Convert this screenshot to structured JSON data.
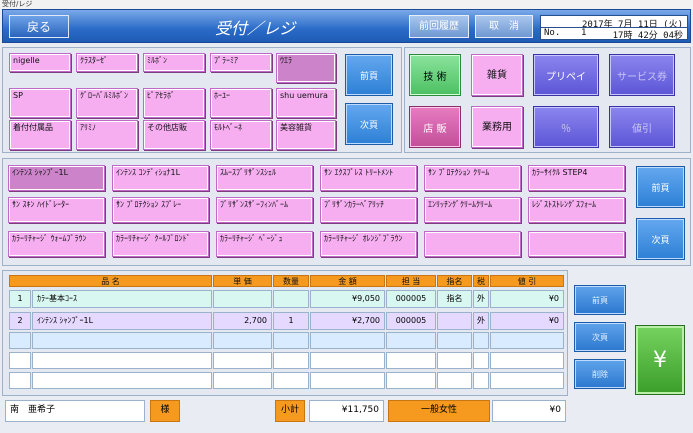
{
  "window": {
    "title": "受付/レジ"
  },
  "header": {
    "back_label": "戻る",
    "title": "受付／レジ",
    "history_label": "前回履歴",
    "cancel_label": "取　消",
    "date": "2017年 7月 11日 (火)",
    "no_label": "No.",
    "no_value": "1",
    "time": "17時 42分 04秒"
  },
  "categories": [
    "nigelle",
    "ｸﾗｽﾀｰｾﾞ",
    "ﾐﾙﾎﾞﾝ",
    "ﾌﾟﾗｰﾐｱ",
    "ｳｴﾗ",
    "SP",
    "ｸﾞﾛｰﾊﾞﾙﾐﾙﾎﾞﾝ",
    "ﾋﾟｱｾﾗﾎﾞ",
    "ﾎｰﾕｰ",
    "shu uemura",
    "着付付属品",
    "ｱﾘﾐﾉ",
    "その他店販",
    "ﾓﾙﾄﾍﾞｰﾈ",
    "美容雑貨"
  ],
  "cat_nav": {
    "prev": "前頁",
    "next": "次頁"
  },
  "modes": {
    "tech": "技 術",
    "misc": "雑貨",
    "prepaid": "プリペイ",
    "service_ticket": "サービス券",
    "store": "店 販",
    "business": "業務用",
    "percent": "％",
    "discount": "値引"
  },
  "products": [
    "ｲﾝﾃﾝｽ ｼｬﾝﾌﾟｰ1L",
    "ｲﾝﾃﾝｽ ｺﾝﾃﾞｨｼｮﾅ1L",
    "ｽﾑｰｽﾌﾞﾘｻﾞﾝｽｼｪﾙ",
    "ｻﾝ ｴｸｽﾌﾟﾚｽ ﾄﾘｰﾄﾒﾝﾄ",
    "ｻﾝ ﾌﾟﾛﾃｸｼｮﾝ ｸﾘｰﾑ",
    "ｶﾗｰｻｲｸﾙ STEP4",
    "ｻﾝ ｽｷﾝ ﾊｲﾄﾞﾚｰﾀｰ",
    "ｻﾝ ﾌﾟﾛﾃｸｼｮﾝ ｽﾌﾟﾚｰ",
    "ﾌﾞﾘｻﾞﾝｽｻﾞｰﾌｨﾝﾊﾞｰﾑ",
    "ﾌﾞﾘｻﾞﾝｶﾗｰﾍﾞｱﾘｯﾁ",
    "ｴﾝﾘｯﾁﾝｸﾞｸﾘｰﾑｸﾘｰﾑ",
    "ﾚｼﾞｽﾄｽﾄﾚﾝｸﾞｽﾌｫｰﾑ",
    "ｶﾗｰﾘﾁｬｰｼﾞ ｳｫｰﾑﾌﾞﾗｳﾝ",
    "ｶﾗｰﾘﾁｬｰｼﾞ ｸｰﾙﾌﾞﾛﾝﾄﾞ",
    "ｶﾗｰﾘﾁｬｰｼﾞ ﾍﾞｰｼﾞｭ",
    "ｶﾗｰﾘﾁｬｰｼﾞ ｵﾚﾝｼﾞﾌﾞﾗｳﾝ",
    "",
    ""
  ],
  "prod_nav": {
    "prev": "前頁",
    "next": "次頁"
  },
  "table": {
    "headers": {
      "name": "品 名",
      "price": "単 価",
      "qty": "数量",
      "amount": "金 額",
      "staff": "担 当",
      "nominated": "指名",
      "tax": "税",
      "discount": "値 引"
    },
    "rows": [
      {
        "no": "1",
        "name": "ｶﾗｰ基本ｺｰｽ",
        "price": "",
        "qty": "",
        "amount": "¥9,050",
        "staff": "000005",
        "nominated": "指名",
        "tax": "外",
        "discount": "¥0"
      },
      {
        "no": "2",
        "name": "ｲﾝﾃﾝｽ ｼｬﾝﾌﾟｰ1L",
        "price": "2,700",
        "qty": "1",
        "amount": "¥2,700",
        "staff": "000005",
        "nominated": "",
        "tax": "外",
        "discount": "¥0"
      }
    ]
  },
  "side": {
    "prev": "前頁",
    "next": "次頁",
    "delete": "削除"
  },
  "pay_label": "¥",
  "footer": {
    "customer": "南　亜希子",
    "honorific": "様",
    "subtotal_label": "小計",
    "subtotal": "¥11,750",
    "customer_type": "一般女性",
    "amount": "¥0"
  },
  "colors": {
    "pink_button": "#f6aef1",
    "header_blue": "#2a6bc8",
    "table_header": "#f59a1f"
  }
}
